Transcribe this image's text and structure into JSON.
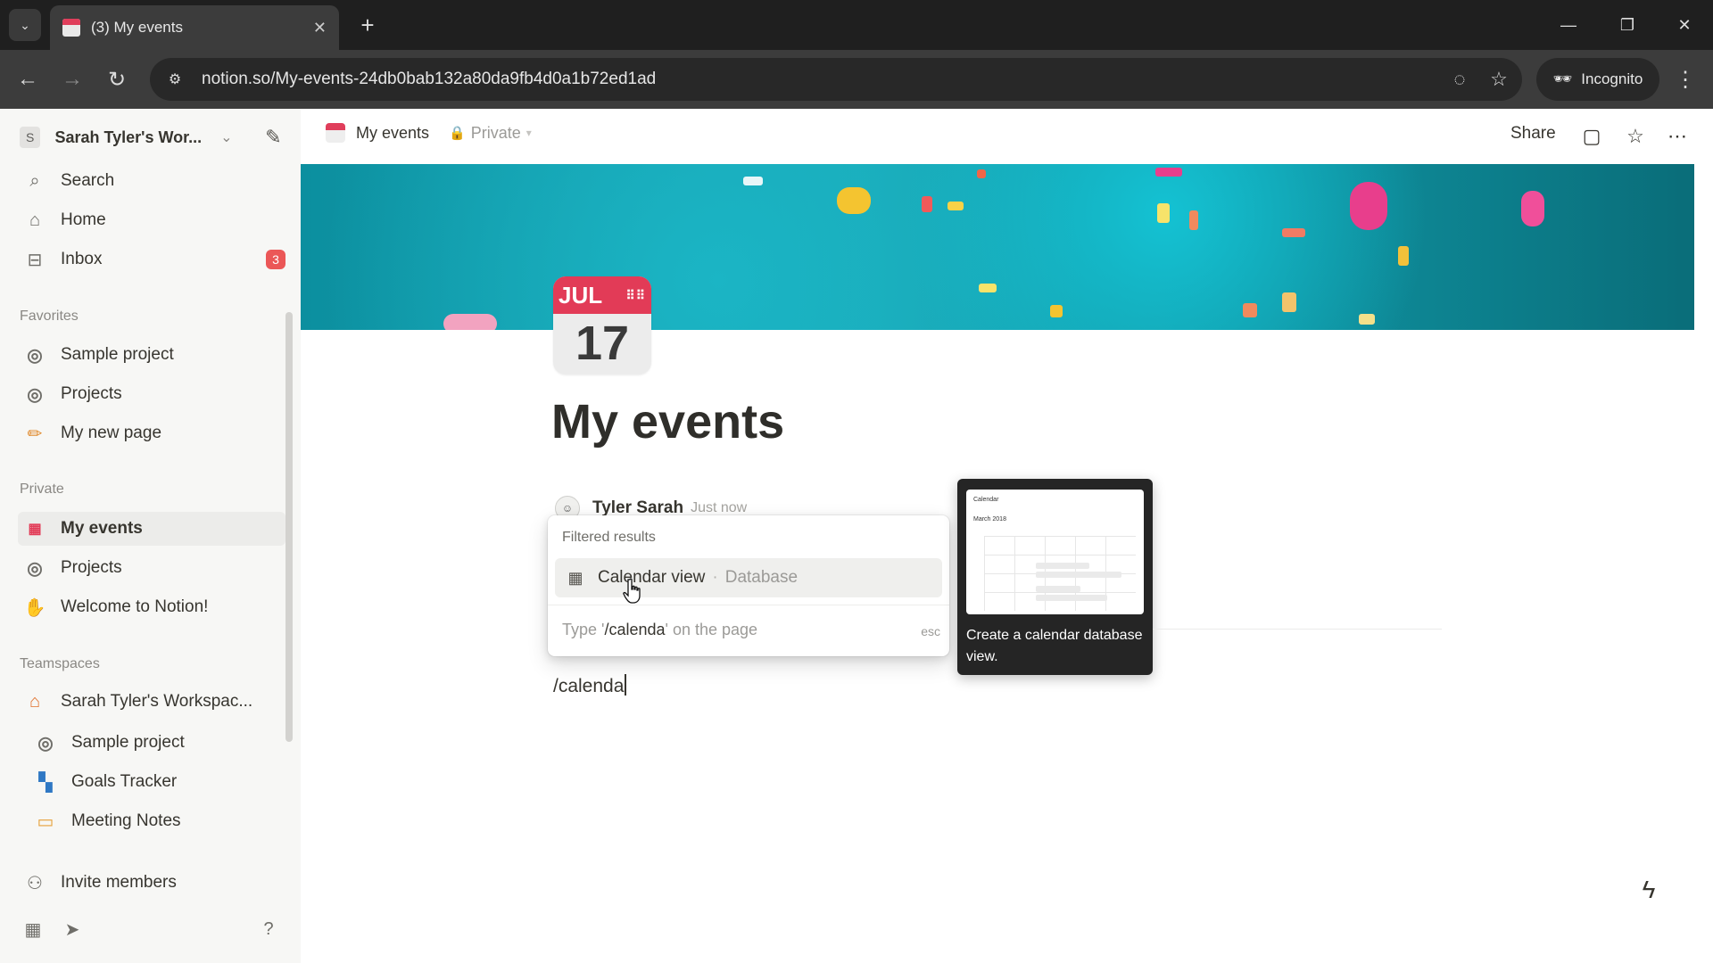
{
  "browser": {
    "tab": {
      "title": "(3) My events",
      "close": "✕"
    },
    "new_tab": "+",
    "url": "notion.so/My-events-24db0bab132a80da9fb4d0a1b72ed1ad",
    "incognito_label": "Incognito",
    "window_controls": {
      "minimize": "—",
      "restore": "❐",
      "close": "✕"
    }
  },
  "sidebar": {
    "workspace_initial": "S",
    "workspace_name": "Sarah Tyler's Wor...",
    "nav": [
      {
        "label": "Search",
        "icon": "search-icon"
      },
      {
        "label": "Home",
        "icon": "home-icon"
      },
      {
        "label": "Inbox",
        "icon": "inbox-icon",
        "badge": "3"
      }
    ],
    "favorites_heading": "Favorites",
    "favorites": [
      {
        "label": "Sample project",
        "icon": "project-icon"
      },
      {
        "label": "Projects",
        "icon": "project-icon"
      },
      {
        "label": "My new page",
        "icon": "pencil-icon"
      }
    ],
    "private_heading": "Private",
    "private": [
      {
        "label": "My events",
        "icon": "calendar-icon",
        "active": true
      },
      {
        "label": "Projects",
        "icon": "project-icon"
      },
      {
        "label": "Welcome to Notion!",
        "icon": "wave-icon"
      }
    ],
    "teamspaces_heading": "Teamspaces",
    "teamspace_name": "Sarah Tyler's Workspac...",
    "teamspace_items": [
      {
        "label": "Sample project",
        "icon": "project-icon"
      },
      {
        "label": "Goals Tracker",
        "icon": "goals-icon"
      },
      {
        "label": "Meeting Notes",
        "icon": "notes-icon"
      }
    ],
    "invite_label": "Invite members"
  },
  "topbar": {
    "breadcrumb": "My events",
    "privacy": "Private",
    "share_label": "Share"
  },
  "page": {
    "icon_month": "JUL",
    "icon_day": "17",
    "title": "My events",
    "comment_author": "Tyler Sarah",
    "comment_time": "Just now",
    "typed_text": "/calenda"
  },
  "slash_menu": {
    "heading": "Filtered results",
    "option_label": "Calendar view",
    "option_separator": "·",
    "option_type": "Database",
    "hint_prefix": "Type '",
    "hint_query": "/calenda",
    "hint_suffix": "' on the page",
    "esc_label": "esc"
  },
  "preview": {
    "thumb_title": "Calendar",
    "thumb_month": "March 2018",
    "description": "Create a calendar database view."
  },
  "colors": {
    "browser_dark": "#1f1f1f",
    "sidebar_bg": "#f7f7f5",
    "badge_red": "#eb5757",
    "cover_teal": "#1aa9b7",
    "calendar_red": "#e23b57"
  }
}
